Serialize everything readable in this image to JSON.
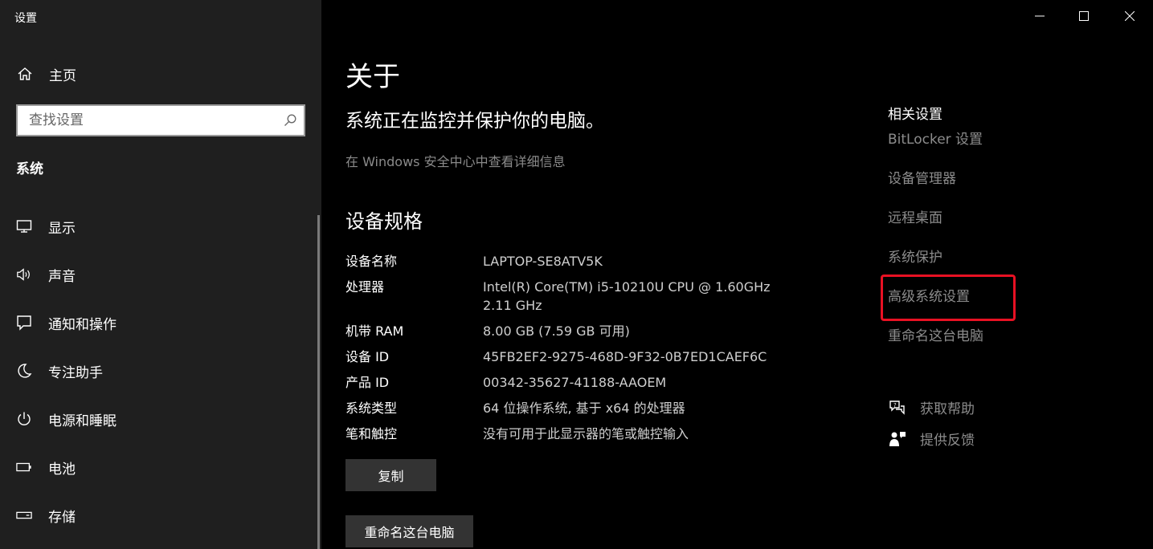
{
  "app": {
    "title": "设置"
  },
  "sidebar": {
    "home_label": "主页",
    "search_placeholder": "查找设置",
    "section_title": "系统",
    "items": [
      {
        "label": "显示",
        "icon": "monitor-icon"
      },
      {
        "label": "声音",
        "icon": "speaker-icon"
      },
      {
        "label": "通知和操作",
        "icon": "notification-icon"
      },
      {
        "label": "专注助手",
        "icon": "moon-icon"
      },
      {
        "label": "电源和睡眠",
        "icon": "power-icon"
      },
      {
        "label": "电池",
        "icon": "battery-icon"
      },
      {
        "label": "存储",
        "icon": "storage-icon"
      }
    ]
  },
  "main": {
    "title": "关于",
    "protect_title": "系统正在监控并保护你的电脑。",
    "defender_link": "在 Windows 安全中心中查看详细信息",
    "spec_title": "设备规格",
    "specs": [
      {
        "key": "设备名称",
        "value": "LAPTOP-SE8ATV5K"
      },
      {
        "key": "处理器",
        "value": "Intel(R) Core(TM) i5-10210U CPU @ 1.60GHz   2.11 GHz"
      },
      {
        "key": "机带 RAM",
        "value": "8.00 GB (7.59 GB 可用)"
      },
      {
        "key": "设备 ID",
        "value": "45FB2EF2-9275-468D-9F32-0B7ED1CAEF6C"
      },
      {
        "key": "产品 ID",
        "value": "00342-35627-41188-AAOEM"
      },
      {
        "key": "系统类型",
        "value": "64 位操作系统, 基于 x64 的处理器"
      },
      {
        "key": "笔和触控",
        "value": "没有可用于此显示器的笔或触控输入"
      }
    ],
    "copy_button": "复制",
    "rename_button": "重命名这台电脑"
  },
  "related": {
    "title": "相关设置",
    "links": [
      "BitLocker 设置",
      "设备管理器",
      "远程桌面",
      "系统保护",
      "高级系统设置",
      "重命名这台电脑"
    ]
  },
  "help": {
    "get_help": "获取帮助",
    "feedback": "提供反馈"
  },
  "colors": {
    "highlight": "#e81123",
    "sidebar_bg": "#1f1f1f",
    "link_gray": "#8c8c8c"
  }
}
